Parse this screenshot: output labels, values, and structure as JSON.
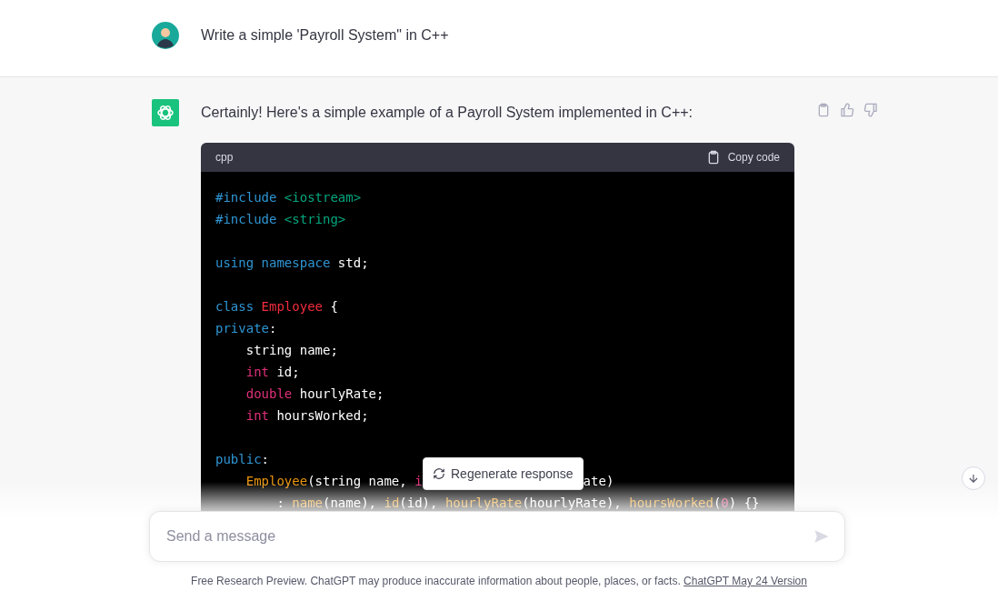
{
  "user_message": {
    "text": "Write a simple 'Payroll System\" in C++"
  },
  "assistant_message": {
    "text": "Certainly! Here's a simple example of a Payroll System implemented in C++:",
    "code_block": {
      "language": "cpp",
      "copy_label": "Copy code",
      "lines": [
        {
          "kind": "code",
          "tokens": [
            {
              "kind": "keyword",
              "text": "#include "
            },
            {
              "kind": "string",
              "text": "<iostream>"
            }
          ]
        },
        {
          "kind": "code",
          "tokens": [
            {
              "kind": "keyword",
              "text": "#include "
            },
            {
              "kind": "string",
              "text": "<string>"
            }
          ]
        },
        {
          "kind": "blank"
        },
        {
          "kind": "code",
          "tokens": [
            {
              "kind": "keyword",
              "text": "using namespace"
            },
            {
              "kind": "plain",
              "text": " std;"
            }
          ]
        },
        {
          "kind": "blank"
        },
        {
          "kind": "code",
          "tokens": [
            {
              "kind": "keyword",
              "text": "class "
            },
            {
              "kind": "title",
              "text": "Employee"
            },
            {
              "kind": "plain",
              "text": " {"
            }
          ]
        },
        {
          "kind": "code",
          "tokens": [
            {
              "kind": "keyword",
              "text": "private"
            },
            {
              "kind": "plain",
              "text": ":"
            }
          ]
        },
        {
          "kind": "code",
          "tokens": [
            {
              "kind": "plain",
              "text": "    string name;"
            }
          ]
        },
        {
          "kind": "code",
          "tokens": [
            {
              "kind": "type",
              "text": "    int"
            },
            {
              "kind": "plain",
              "text": " id;"
            }
          ]
        },
        {
          "kind": "code",
          "tokens": [
            {
              "kind": "type",
              "text": "    double"
            },
            {
              "kind": "plain",
              "text": " hourlyRate;"
            }
          ]
        },
        {
          "kind": "code",
          "tokens": [
            {
              "kind": "type",
              "text": "    int"
            },
            {
              "kind": "plain",
              "text": " hoursWorked;"
            }
          ]
        },
        {
          "kind": "blank"
        },
        {
          "kind": "code",
          "tokens": [
            {
              "kind": "keyword",
              "text": "public"
            },
            {
              "kind": "plain",
              "text": ":"
            }
          ]
        },
        {
          "kind": "code",
          "tokens": [
            {
              "kind": "function",
              "text": "    Employee"
            },
            {
              "kind": "plain",
              "text": "(string name, "
            },
            {
              "kind": "type",
              "text": "i"
            },
            {
              "kind": "plain",
              "text": "                     ate)"
            }
          ]
        },
        {
          "kind": "code",
          "tokens": [
            {
              "kind": "plain",
              "text": "        : "
            },
            {
              "kind": "function",
              "text": "name"
            },
            {
              "kind": "plain",
              "text": "(name), "
            },
            {
              "kind": "function",
              "text": "id"
            },
            {
              "kind": "plain",
              "text": "(id), "
            },
            {
              "kind": "function",
              "text": "hourlyRate"
            },
            {
              "kind": "plain",
              "text": "(hourlyRate), "
            },
            {
              "kind": "function",
              "text": "hoursWorked"
            },
            {
              "kind": "plain",
              "text": "("
            },
            {
              "kind": "number",
              "text": "0"
            },
            {
              "kind": "plain",
              "text": ") {}"
            }
          ]
        }
      ]
    }
  },
  "regenerate_button": {
    "label": "Regenerate response"
  },
  "composer": {
    "placeholder": "Send a message"
  },
  "footer": {
    "text": "Free Research Preview. ChatGPT may produce inaccurate information about people, places, or facts.",
    "link": "ChatGPT May 24 Version"
  }
}
